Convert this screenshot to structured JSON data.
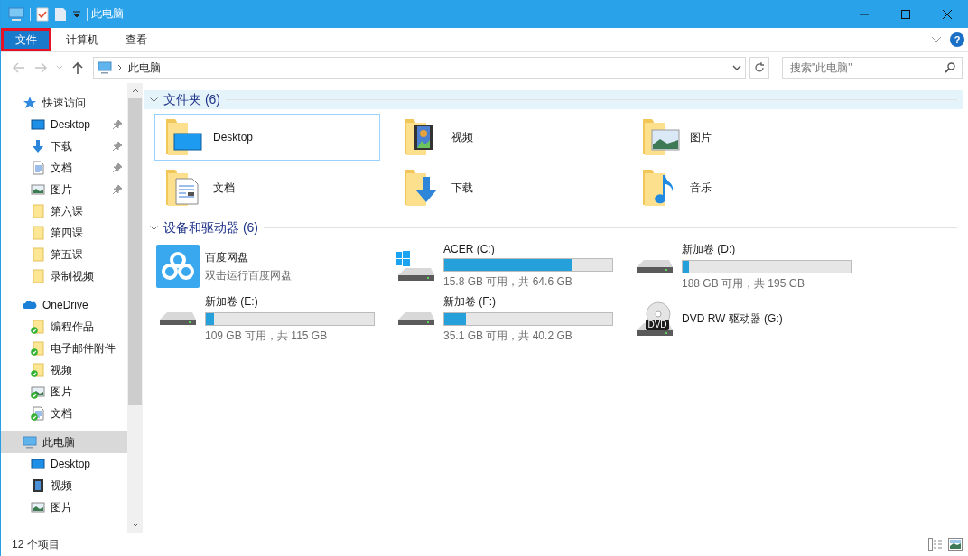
{
  "window": {
    "title": "此电脑"
  },
  "ribbon": {
    "tabs": [
      {
        "label": "文件",
        "selected": true
      },
      {
        "label": "计算机",
        "selected": false
      },
      {
        "label": "查看",
        "selected": false
      }
    ],
    "help": "?"
  },
  "address": {
    "path": [
      "此电脑"
    ],
    "search_placeholder": "搜索\"此电脑\""
  },
  "nav": [
    {
      "label": "快速访问",
      "kind": "star",
      "selected": false,
      "children": [
        {
          "label": "Desktop",
          "kind": "desktop",
          "pinned": true,
          "synced": false,
          "selected": false
        },
        {
          "label": "下载",
          "kind": "download",
          "pinned": true,
          "synced": false,
          "selected": false
        },
        {
          "label": "文档",
          "kind": "document",
          "pinned": true,
          "synced": false,
          "selected": false
        },
        {
          "label": "图片",
          "kind": "pictures",
          "pinned": true,
          "synced": false,
          "selected": false
        },
        {
          "label": "第六课",
          "kind": "folder",
          "pinned": false,
          "synced": false,
          "selected": false
        },
        {
          "label": "第四课",
          "kind": "folder",
          "pinned": false,
          "synced": false,
          "selected": false
        },
        {
          "label": "第五课",
          "kind": "folder",
          "pinned": false,
          "synced": false,
          "selected": false
        },
        {
          "label": "录制视频",
          "kind": "folder",
          "pinned": false,
          "synced": false,
          "selected": false
        }
      ]
    },
    {
      "label": "OneDrive",
      "kind": "cloud",
      "selected": false,
      "children": [
        {
          "label": "编程作品",
          "kind": "folder",
          "pinned": false,
          "synced": true,
          "selected": false
        },
        {
          "label": "电子邮件附件",
          "kind": "folder",
          "pinned": false,
          "synced": true,
          "selected": false
        },
        {
          "label": "视频",
          "kind": "folder",
          "pinned": false,
          "synced": true,
          "selected": false
        },
        {
          "label": "图片",
          "kind": "pictures",
          "pinned": false,
          "synced": true,
          "selected": false
        },
        {
          "label": "文档",
          "kind": "document",
          "pinned": false,
          "synced": true,
          "selected": false
        }
      ]
    },
    {
      "label": "此电脑",
      "kind": "pc",
      "selected": true,
      "children": [
        {
          "label": "Desktop",
          "kind": "desktop",
          "pinned": false,
          "synced": false,
          "selected": false
        },
        {
          "label": "视频",
          "kind": "video",
          "pinned": false,
          "synced": false,
          "selected": false
        },
        {
          "label": "图片",
          "kind": "pictures",
          "pinned": false,
          "synced": false,
          "selected": false
        }
      ]
    }
  ],
  "sections": [
    {
      "title": "文件夹 (6)",
      "focused": true,
      "items": [
        {
          "kind": "desktop",
          "label": "Desktop",
          "selected": true
        },
        {
          "kind": "video",
          "label": "视频",
          "selected": false
        },
        {
          "kind": "pictures",
          "label": "图片",
          "selected": false
        },
        {
          "kind": "document",
          "label": "文档",
          "selected": false
        },
        {
          "kind": "download",
          "label": "下载",
          "selected": false
        },
        {
          "kind": "music",
          "label": "音乐",
          "selected": false
        }
      ]
    },
    {
      "title": "设备和驱动器 (6)",
      "focused": false,
      "items": [
        {
          "kind": "app",
          "label": "百度网盘",
          "subtitle": "双击运行百度网盘"
        },
        {
          "kind": "system_drive",
          "label": "ACER (C:)",
          "level": 0.76,
          "info": "15.8 GB 可用，共 64.6 GB"
        },
        {
          "kind": "drive",
          "label": "新加卷 (D:)",
          "level": 0.04,
          "info": "188 GB 可用，共 195 GB"
        },
        {
          "kind": "drive",
          "label": "新加卷 (E:)",
          "level": 0.05,
          "info": "109 GB 可用，共 115 GB"
        },
        {
          "kind": "drive",
          "label": "新加卷 (F:)",
          "level": 0.13,
          "info": "35.1 GB 可用，共 40.2 GB"
        },
        {
          "kind": "dvd",
          "label": "DVD RW 驱动器 (G:)",
          "badge": "DVD"
        }
      ]
    }
  ],
  "status_bar": {
    "count": "12 个项目"
  }
}
